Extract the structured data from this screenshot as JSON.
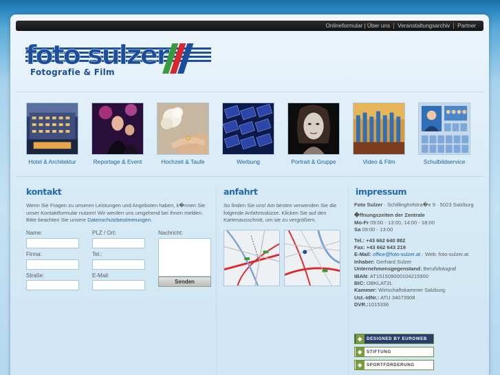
{
  "nav": {
    "items": [
      "Onlineformular | Über uns",
      "Veranstaltungsarchiv",
      "Partner"
    ]
  },
  "logo": {
    "text": "foto sulzer",
    "subtitle": "Fotografie & Film"
  },
  "categories": [
    {
      "label": "Hotel & Architektur"
    },
    {
      "label": "Reportage & Event"
    },
    {
      "label": "Hochzeit & Taufe"
    },
    {
      "label": "Werbung"
    },
    {
      "label": "Portrait & Gruppe"
    },
    {
      "label": "Video & Film"
    },
    {
      "label": "Schulbildservice"
    }
  ],
  "kontakt": {
    "title": "kontakt",
    "intro": "Wenn Sie Fragen zu unseren Leistungen und Angeboten haben, k�nnen Sie unser Kontaktformular nutzen! Wir werden uns umgehend bei Ihnen melden. Bitte beachten Sie unsere",
    "link": "Datenschutzbestimmungen",
    "after_link": ".",
    "labels": {
      "name": "Name:",
      "plz": "PLZ / Ort:",
      "nachricht": "Nachricht:",
      "firma": "Firma:",
      "tel": "Tel.:",
      "strasse": "Straße:",
      "email": "E-Mail:"
    },
    "send": "Senden"
  },
  "anfahrt": {
    "title": "anfahrt",
    "text": "So finden Sie uns! Am besten verwenden Sie die folgende Anfahrtsskizze. Klicken Sie auf den Kartenausschnitt, um sie zu vergrößern."
  },
  "impressum": {
    "title": "impressum",
    "company": "Foto Sulzer",
    "address": " · Schillinghofstra�e 9 · 5023 Salzburg",
    "hours_title": "�ffnungszeiten der Zentrale",
    "hours_mofr_label": "Mo-Fr",
    "hours_mofr": " 09:00 - 13:00, 14:00 - 18:00",
    "hours_sa_label": "Sa",
    "hours_sa": " 09:00 - 13:00",
    "tel": "Tel.: +43 662 640 882",
    "fax": "Fax: +43 662 643 219",
    "email_label": "E-Mail: ",
    "email": "office@foto-sulzer.at",
    "web_label": " · Web: ",
    "web": "foto-sulzer.at",
    "owner_label": "Inhaber:",
    "owner": " Gerhard Sulzer",
    "subject_label": "Unternehmensgegenstand:",
    "subject": " Berufsfotograf",
    "iban_label": "IBAN:",
    "iban": " AT151509000104215900",
    "bic_label": "BIC:",
    "bic": " OBKLAT2L",
    "kammer_label": "Kammer:",
    "kammer": " Wirtschaftskammer Salzburg",
    "uid_label": "Ust.-IdNr.:",
    "uid": " ATU 34073908",
    "dvr_label": "DVR.:",
    "dvr": "1015336"
  },
  "badges": [
    {
      "label": "DESIGNED BY EUROWEB",
      "color": "#2c3e6e"
    },
    {
      "label": "STIFTUNG",
      "color": "#3a3a3a"
    },
    {
      "label": "SPORTFÖRDERUNG",
      "color": "#3a3a3a"
    }
  ],
  "colors": {
    "accent": "#2469b0",
    "link": "#1f5fa0",
    "logo_blue": "#1d4e9b",
    "logo_green": "#3a9a3e",
    "logo_red": "#d7282f"
  }
}
